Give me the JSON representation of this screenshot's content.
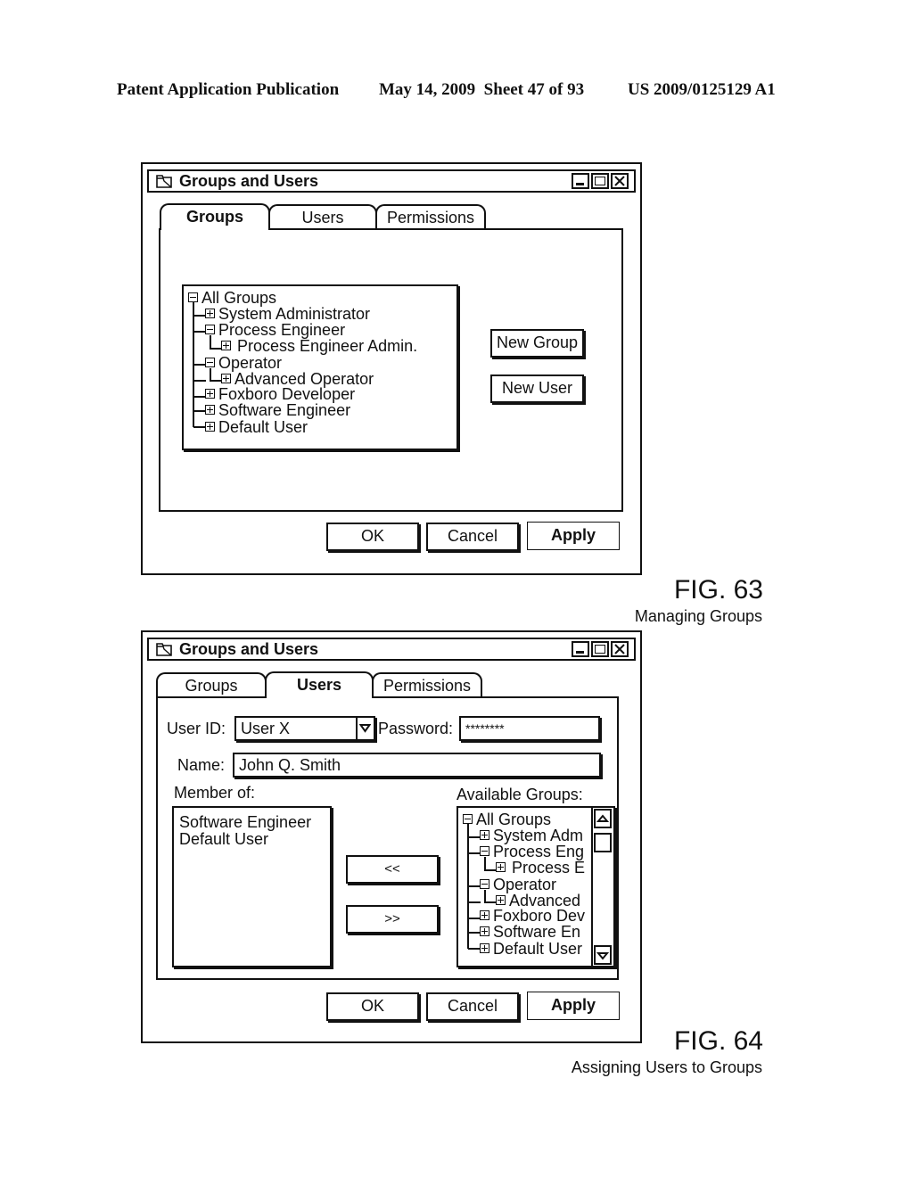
{
  "header": {
    "publication": "Patent Application Publication",
    "date_sheet": "May 14, 2009  Sheet 47 of 93",
    "number": "US 2009/0125129 A1"
  },
  "fig63": {
    "window_title": "Groups and Users",
    "window_icon": "folder-window-icon",
    "window_controls": [
      "minimize-icon",
      "maximize-icon",
      "close-icon"
    ],
    "tabs": [
      {
        "label": "Groups",
        "active": true
      },
      {
        "label": "Users",
        "active": false
      },
      {
        "label": "Permissions",
        "active": false
      }
    ],
    "tree": [
      {
        "label": "All Groups",
        "depth": 0,
        "expander": "minus"
      },
      {
        "label": "System Administrator",
        "depth": 1,
        "expander": "plus"
      },
      {
        "label": "Process Engineer",
        "depth": 1,
        "expander": "minus"
      },
      {
        "label": "Process Engineer Admin.",
        "depth": 2,
        "expander": "plus"
      },
      {
        "label": "Operator",
        "depth": 1,
        "expander": "minus"
      },
      {
        "label": "Advanced Operator",
        "depth": 2,
        "expander": "plus"
      },
      {
        "label": "Foxboro Developer",
        "depth": 1,
        "expander": "plus"
      },
      {
        "label": "Software Engineer",
        "depth": 1,
        "expander": "plus"
      },
      {
        "label": "Default User",
        "depth": 1,
        "expander": "plus"
      }
    ],
    "buttons": {
      "new_group": "New Group",
      "new_user": "New User",
      "ok": "OK",
      "cancel": "Cancel",
      "apply": "Apply"
    },
    "figure_label": "FIG. 63",
    "caption": "Managing Groups"
  },
  "fig64": {
    "window_title": "Groups and Users",
    "window_icon": "folder-window-icon",
    "window_controls": [
      "minimize-icon",
      "maximize-icon",
      "close-icon"
    ],
    "tabs": [
      {
        "label": "Groups",
        "active": false
      },
      {
        "label": "Users",
        "active": true
      },
      {
        "label": "Permissions",
        "active": false
      }
    ],
    "user_id_label": "User ID:",
    "user_id_value": "User X",
    "password_label": "Password:",
    "password_value": "********",
    "name_label": "Name:",
    "name_value": "John Q. Smith",
    "member_of_label": "Member of:",
    "member_of": [
      "Software Engineer",
      "Default User"
    ],
    "available_label": "Available Groups:",
    "available_tree": [
      {
        "label": "All Groups",
        "depth": 0,
        "expander": "minus"
      },
      {
        "label": "System Adm",
        "depth": 1,
        "expander": "plus"
      },
      {
        "label": "Process Eng",
        "depth": 1,
        "expander": "minus"
      },
      {
        "label": "Process E",
        "depth": 2,
        "expander": "plus"
      },
      {
        "label": "Operator",
        "depth": 1,
        "expander": "minus"
      },
      {
        "label": "Advanced",
        "depth": 2,
        "expander": "plus"
      },
      {
        "label": "Foxboro Dev",
        "depth": 1,
        "expander": "plus"
      },
      {
        "label": "Software En",
        "depth": 1,
        "expander": "plus"
      },
      {
        "label": "Default User",
        "depth": 1,
        "expander": "plus"
      }
    ],
    "buttons": {
      "add": "<<",
      "remove": ">>",
      "ok": "OK",
      "cancel": "Cancel",
      "apply": "Apply"
    },
    "figure_label": "FIG. 64",
    "caption": "Assigning Users to Groups"
  }
}
